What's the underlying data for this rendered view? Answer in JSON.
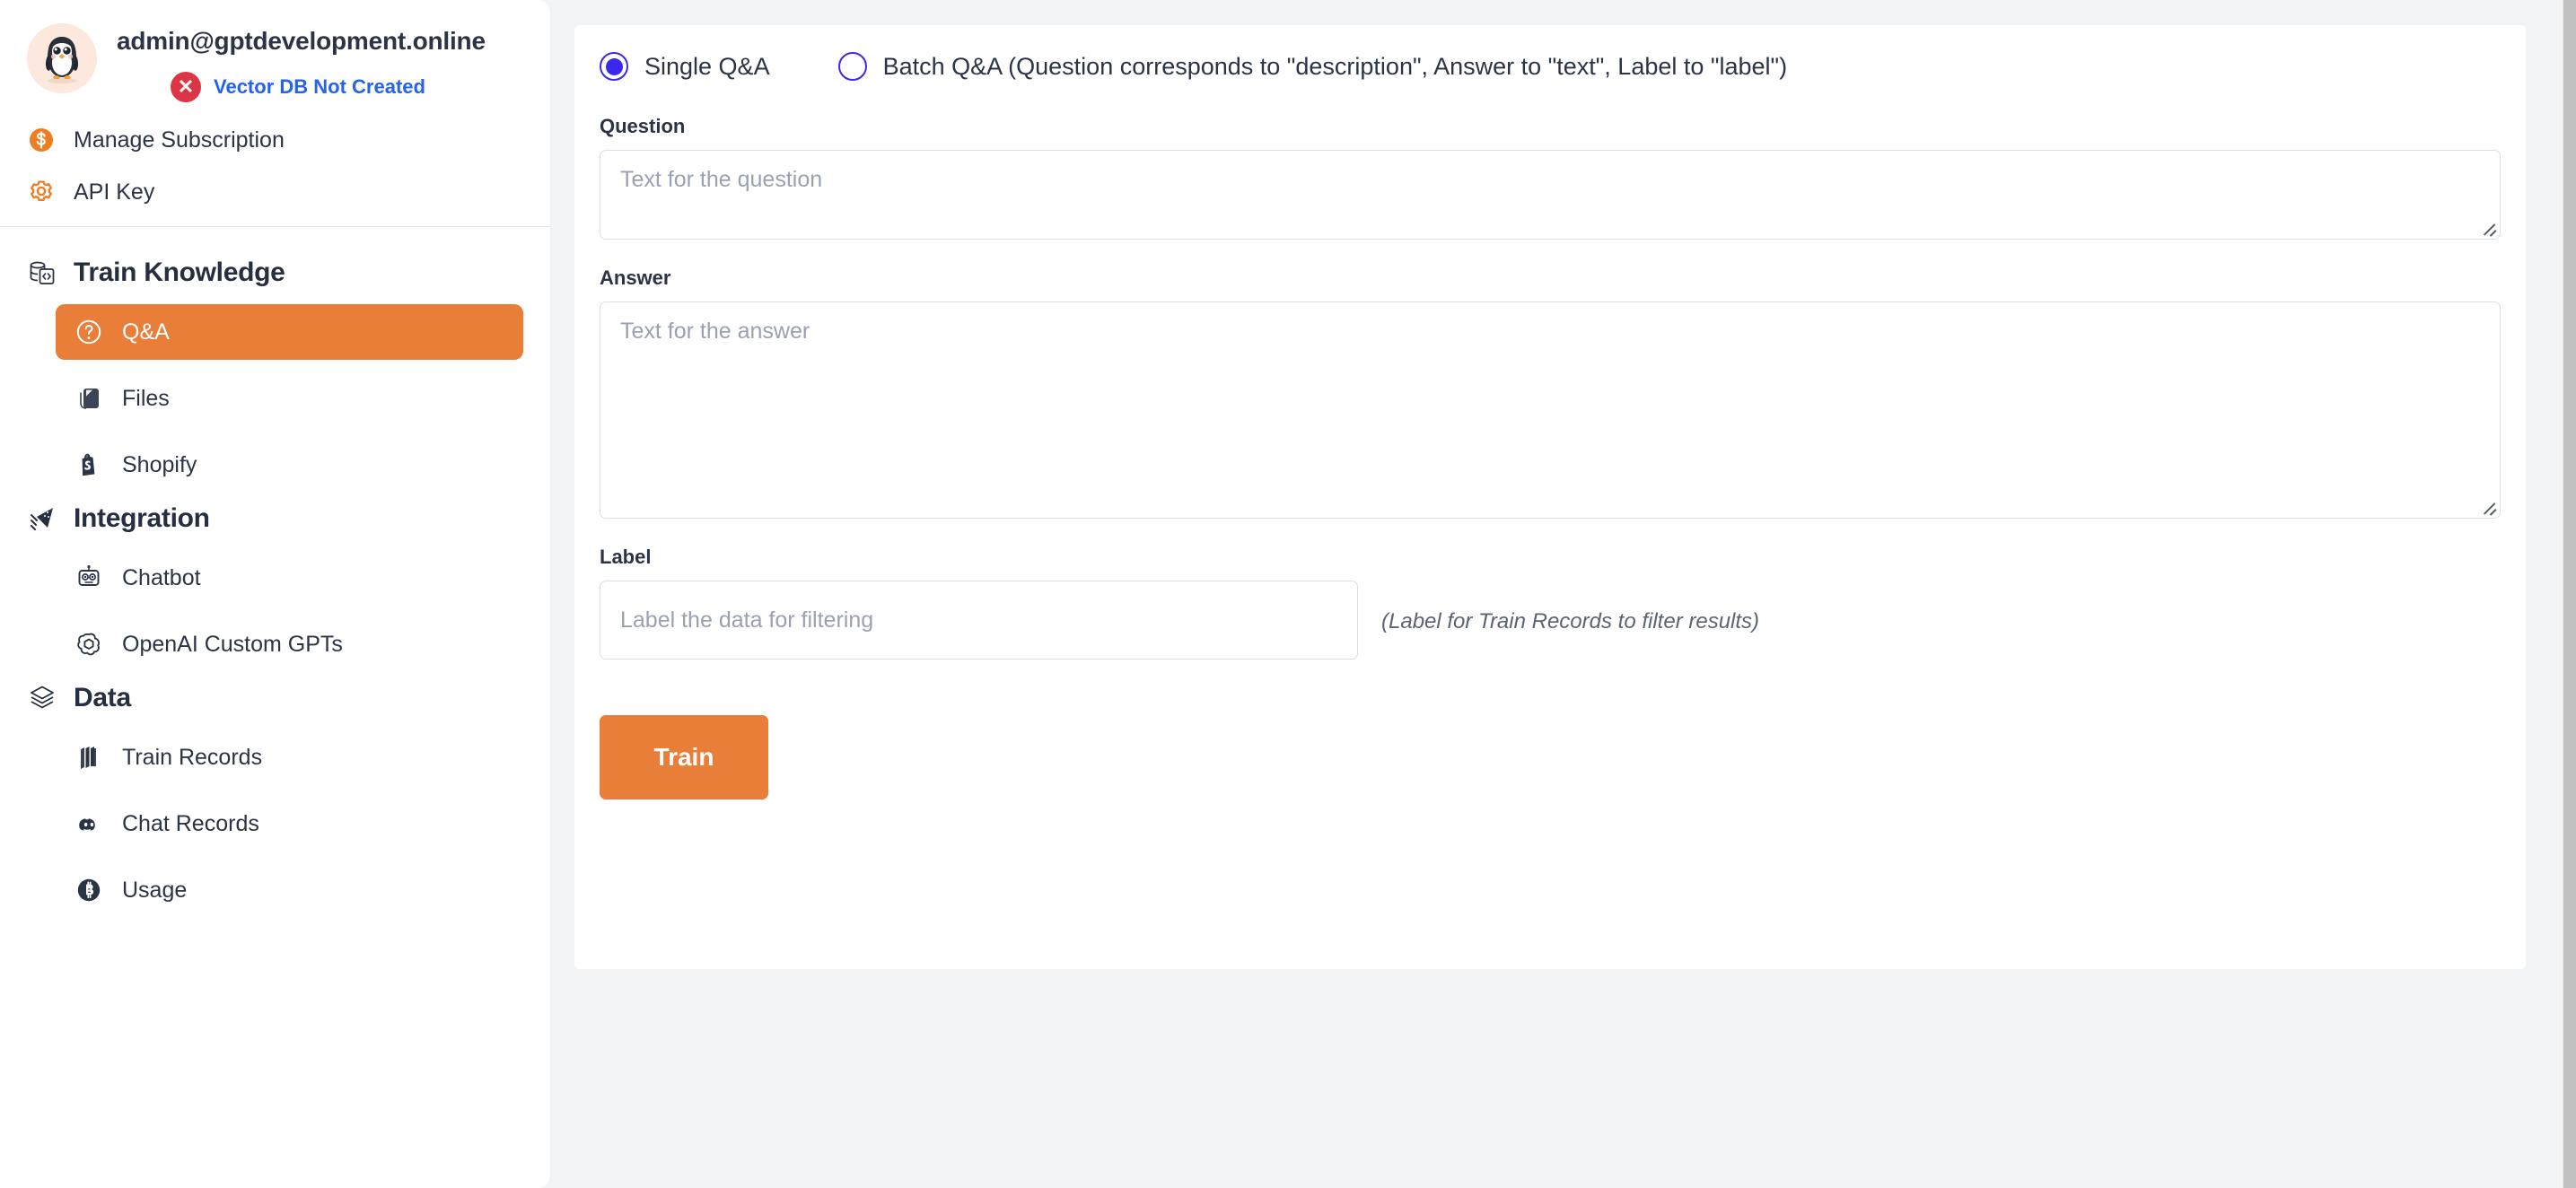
{
  "colors": {
    "accent_orange": "#e87e38",
    "radio_indigo": "#3b28ec",
    "status_red": "#dc3545",
    "status_link_blue": "#2563eb",
    "page_background": "#f1f3f5",
    "card_background": "#ffffff",
    "text_dark": "#2b3445",
    "placeholder_gray": "#9aa1b0",
    "scrollbar_thumb": "#c1c1c1"
  },
  "sidebar": {
    "account": {
      "avatar_icon": "penguin-avatar",
      "email": "admin@gptdevelopment.online",
      "vector_db_status_icon": "error-x-circle-icon",
      "vector_db_status": "Vector DB Not Created",
      "links": [
        {
          "icon": "dollar-circle-icon",
          "label": "Manage Subscription"
        },
        {
          "icon": "gear-icon",
          "label": "API Key"
        }
      ]
    },
    "groups": [
      {
        "icon": "database-code-icon",
        "label": "Train Knowledge",
        "items": [
          {
            "icon": "question-circle-icon",
            "label": "Q&A",
            "active": true
          },
          {
            "icon": "files-icon",
            "label": "Files",
            "active": false
          },
          {
            "icon": "shopify-bag-icon",
            "label": "Shopify",
            "active": false
          }
        ]
      },
      {
        "icon": "integration-arrows-icon",
        "label": "Integration",
        "items": [
          {
            "icon": "robot-chatbot-icon",
            "label": "Chatbot",
            "active": false
          },
          {
            "icon": "openai-logo-icon",
            "label": "OpenAI Custom GPTs",
            "active": false
          }
        ]
      },
      {
        "icon": "layers-stack-icon",
        "label": "Data",
        "items": [
          {
            "icon": "books-icon",
            "label": "Train Records",
            "active": false
          },
          {
            "icon": "discord-icon",
            "label": "Chat Records",
            "active": false
          },
          {
            "icon": "bitcoin-circle-icon",
            "label": "Usage",
            "active": false
          }
        ]
      }
    ]
  },
  "main": {
    "modes": [
      {
        "label": "Single Q&A",
        "checked": true
      },
      {
        "label": "Batch Q&A (Question corresponds to \"description\", Answer to \"text\", Label to \"label\")",
        "checked": false
      }
    ],
    "question": {
      "label": "Question",
      "placeholder": "Text for the question",
      "value": ""
    },
    "answer": {
      "label": "Answer",
      "placeholder": "Text for the answer",
      "value": ""
    },
    "label_field": {
      "label": "Label",
      "placeholder": "Label the data for filtering",
      "value": "",
      "hint": "(Label for Train Records to filter results)"
    },
    "train_button": "Train"
  }
}
